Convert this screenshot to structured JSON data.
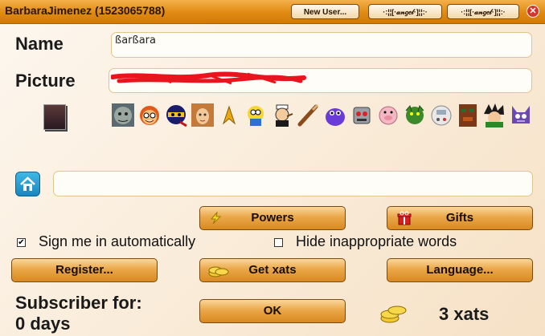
{
  "title_bar": {
    "title": "BarbaraJimenez (1523065788)",
    "new_user_label": "New User...",
    "tab1_label": "·:¦¦[·𝒶𝓃𝑔𝑒𝓁·]¦¦:·",
    "tab2_label": "·:¦¦[·𝒶𝓃𝑔𝑒𝓁·]¦¦:·",
    "close_symbol": "✕"
  },
  "form": {
    "name_label": "Name",
    "name_value": "ßarßara",
    "picture_label": "Picture",
    "picture_value": "",
    "homepage_value": ""
  },
  "buttons": {
    "powers": "Powers",
    "gifts": "Gifts",
    "register": "Register...",
    "get_xats": "Get xats",
    "language": "Language...",
    "ok": "OK"
  },
  "options": {
    "sign_in_label": "Sign me in automatically",
    "sign_in_checked": true,
    "hide_words_label": "Hide inappropriate words",
    "hide_words_checked": false
  },
  "footer": {
    "subscriber_line1": "Subscriber for:",
    "subscriber_line2": "0 days",
    "xats": "3 xats"
  },
  "smileys": [
    "goblin-icon",
    "redhead-smiley-icon",
    "ninja-smiley-icon",
    "girl-face-icon",
    "star-trek-insignia-icon",
    "homer-icon",
    "popeye-icon",
    "wand-icon",
    "purple-monster-icon",
    "robot-smiley-icon",
    "pig-smiley-icon",
    "green-dragon-icon",
    "gameboy-smiley-icon",
    "tiki-totem-icon",
    "goku-icon",
    "crazy-cat-icon"
  ],
  "colors": {
    "title_bar": "#e08a12",
    "button": "#eaa749",
    "field_border": "#e2c58c",
    "close": "#d9342b",
    "home_icon": "#2aa0d6"
  }
}
